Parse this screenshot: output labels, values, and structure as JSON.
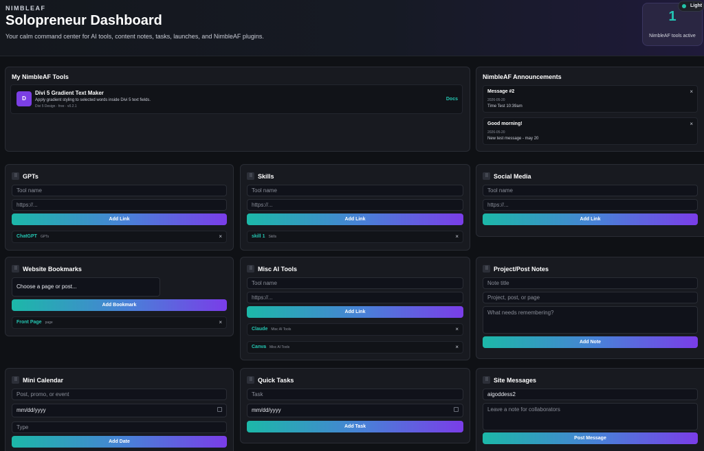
{
  "header": {
    "brand": "NIMBLEAF",
    "title": "Solopreneur Dashboard",
    "subtitle": "Your calm command center for AI tools, content notes, tasks, launches, and NimbleAF plugins.",
    "stat_value": "1",
    "stat_label": "NimbleAF tools active",
    "theme_toggle": "Light"
  },
  "colors": {
    "accent_teal": "#24c6b2",
    "accent_purple": "#7a3de8",
    "background": "#0f1115",
    "card": "#181a20"
  },
  "my_tools": {
    "title": "My NimbleAF Tools",
    "tool": {
      "icon_letter": "D",
      "name": "Divi 5 Gradient Text Maker",
      "description": "Apply gradient styling to selected words inside Divi 5 text fields.",
      "meta": "Divi 5 Design · free · v0.2.1",
      "docs_label": "Docs"
    }
  },
  "announcements": {
    "title": "NimbleAF Announcements",
    "items": [
      {
        "title": "Message #2",
        "date": "2026-05-20",
        "body": "Time Test 10:39am",
        "close": "×"
      },
      {
        "title": "Good morning!",
        "date": "2026-05-20",
        "body": "New test message - may 20",
        "close": "×"
      }
    ]
  },
  "gpts": {
    "title": "GPTs",
    "name_placeholder": "Tool name",
    "url_placeholder": "https://...",
    "button": "Add Link",
    "links": [
      {
        "name": "ChatGPT",
        "category": "GPTs",
        "close": "×"
      }
    ]
  },
  "skills": {
    "title": "Skills",
    "name_placeholder": "Tool name",
    "url_placeholder": "https://...",
    "button": "Add Link",
    "links": [
      {
        "name": "skill 1",
        "category": "Skills",
        "close": "×"
      }
    ]
  },
  "social": {
    "title": "Social Media",
    "name_placeholder": "Tool name",
    "url_placeholder": "https://...",
    "button": "Add Link"
  },
  "bookmarks": {
    "title": "Website Bookmarks",
    "select_value": "Choose a page or post...",
    "button": "Add Bookmark",
    "items": [
      {
        "name": "Front Page",
        "category": "page",
        "close": "×"
      }
    ]
  },
  "misc_ai": {
    "title": "Misc AI Tools",
    "name_placeholder": "Tool name",
    "url_placeholder": "https://...",
    "button": "Add Link",
    "links": [
      {
        "name": "Claude",
        "category": "Misc AI Tools",
        "close": "×"
      },
      {
        "name": "Canva",
        "category": "Misc AI Tools",
        "close": "×"
      }
    ]
  },
  "notes": {
    "title": "Project/Post Notes",
    "title_placeholder": "Note title",
    "project_placeholder": "Project, post, or page",
    "body_placeholder": "What needs remembering?",
    "button": "Add Note"
  },
  "calendar": {
    "title": "Mini Calendar",
    "event_placeholder": "Post, promo, or event",
    "date_value": "mm/dd/yyyy",
    "type_placeholder": "Type",
    "button": "Add Date"
  },
  "tasks": {
    "title": "Quick Tasks",
    "task_placeholder": "Task",
    "date_value": "mm/dd/yyyy",
    "button": "Add Task"
  },
  "site_messages": {
    "title": "Site Messages",
    "user_value": "aigoddess2",
    "note_placeholder": "Leave a note for collaborators",
    "button": "Post Message"
  },
  "handle_glyph": "⠿"
}
